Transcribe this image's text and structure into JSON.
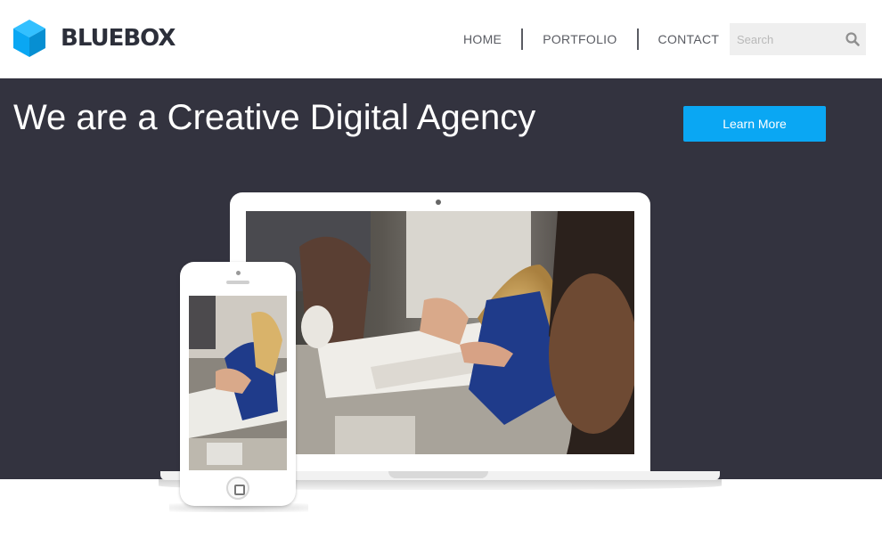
{
  "brand": {
    "name": "BLUEBOX",
    "accent": "#0aa7f3",
    "logo_icon": "cube-icon"
  },
  "nav": {
    "items": [
      {
        "label": "HOME"
      },
      {
        "label": "PORTFOLIO"
      },
      {
        "label": "CONTACT"
      }
    ]
  },
  "search": {
    "placeholder": "Search",
    "value": "",
    "icon": "search-icon"
  },
  "hero": {
    "title": "We are a Creative Digital Agency",
    "cta_label": "Learn More",
    "background": "#33333f"
  }
}
